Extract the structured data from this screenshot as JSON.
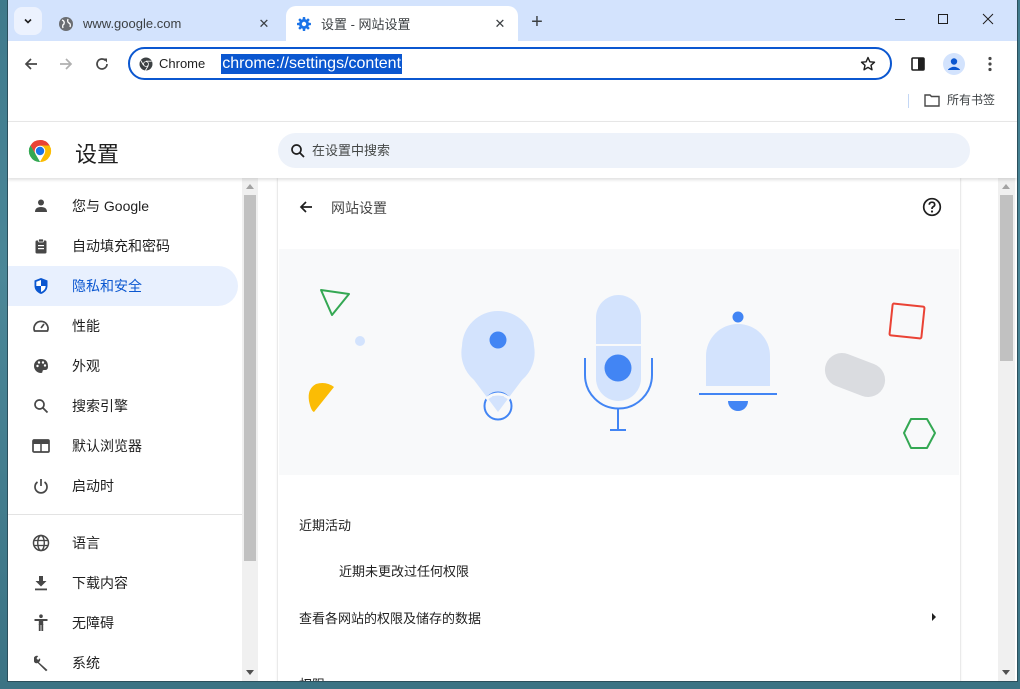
{
  "browser": {
    "tabs": [
      {
        "title": "www.google.com",
        "favicon": "globe-icon",
        "active": false
      },
      {
        "title": "设置 - 网站设置",
        "favicon": "gear-icon",
        "active": true
      }
    ],
    "new_tab_label": "+",
    "window_controls": {
      "minimize": "minimize-icon",
      "maximize": "maximize-icon",
      "close": "close-icon"
    },
    "omnibox": {
      "chip_label": "Chrome",
      "url": "chrome://settings/content"
    },
    "bookmarks": {
      "all_bookmarks_label": "所有书签"
    }
  },
  "settings": {
    "title": "设置",
    "search_placeholder": "在设置中搜索",
    "sidebar": {
      "items": [
        {
          "label": "您与 Google",
          "icon": "person-icon"
        },
        {
          "label": "自动填充和密码",
          "icon": "clipboard-icon"
        },
        {
          "label": "隐私和安全",
          "icon": "shield-icon",
          "selected": true
        },
        {
          "label": "性能",
          "icon": "speedometer-icon"
        },
        {
          "label": "外观",
          "icon": "palette-icon"
        },
        {
          "label": "搜索引擎",
          "icon": "search-icon"
        },
        {
          "label": "默认浏览器",
          "icon": "browser-window-icon"
        },
        {
          "label": "启动时",
          "icon": "power-icon"
        },
        {
          "label": "语言",
          "icon": "globe-icon"
        },
        {
          "label": "下载内容",
          "icon": "download-icon"
        },
        {
          "label": "无障碍",
          "icon": "accessibility-icon"
        },
        {
          "label": "系统",
          "icon": "wrench-icon"
        }
      ]
    },
    "page": {
      "title": "网站设置",
      "recent_activity_label": "近期活动",
      "recent_activity_empty": "近期未更改过任何权限",
      "site_data_link": "查看各网站的权限及储存的数据",
      "permissions_label": "权限"
    },
    "colors": {
      "accent": "#0b57d0",
      "selected_bg": "#e8f0fe",
      "tabstrip_bg": "#d3e3fd",
      "illustration_blue": "#4285f4",
      "illustration_light_blue": "#d3e3fd",
      "illustration_green": "#34a853",
      "illustration_yellow": "#fbbc04",
      "illustration_red": "#ea4335",
      "illustration_gray": "#dadce0"
    }
  }
}
